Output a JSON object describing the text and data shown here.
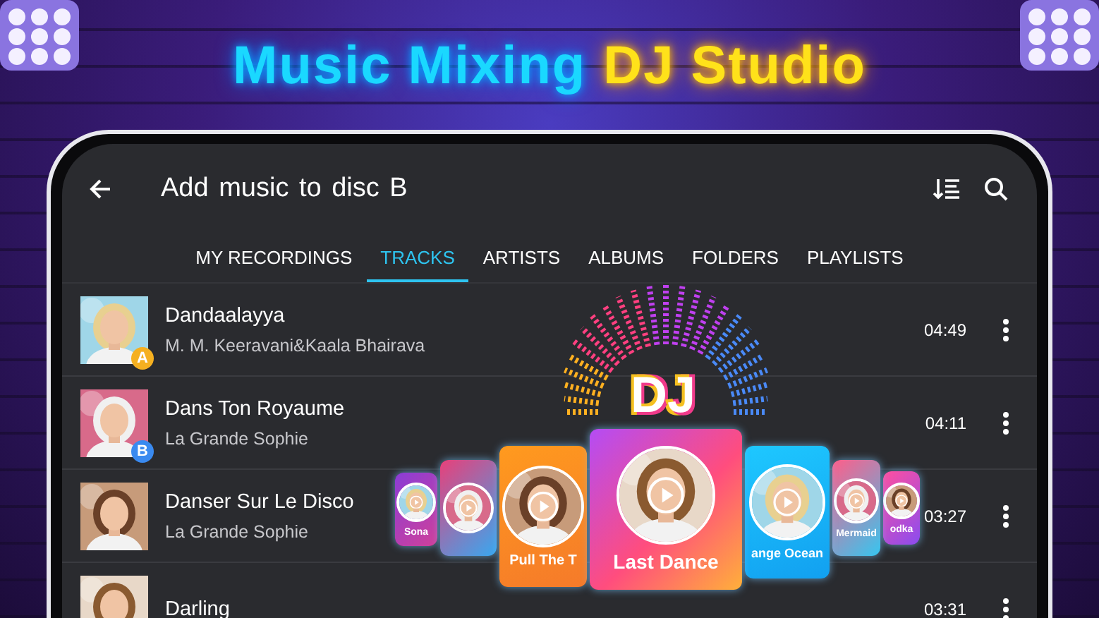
{
  "banner": {
    "title_start": "Music Mixing",
    "title_end": "DJ Studio"
  },
  "app_bar": {
    "title": "Add music to disc B"
  },
  "tabs": [
    {
      "label": "MY RECORDINGS",
      "selected": false
    },
    {
      "label": "TRACKS",
      "selected": true
    },
    {
      "label": "ARTISTS",
      "selected": false
    },
    {
      "label": "ALBUMS",
      "selected": false
    },
    {
      "label": "FOLDERS",
      "selected": false
    },
    {
      "label": "PLAYLISTS",
      "selected": false
    }
  ],
  "tracks": [
    {
      "title": "Dandaalayya",
      "artist": "M. M. Keeravani&Kaala Bhairava",
      "duration": "04:49",
      "badge": "A"
    },
    {
      "title": "Dans Ton Royaume",
      "artist": "La Grande Sophie",
      "duration": "04:11",
      "badge": "B"
    },
    {
      "title": "Danser Sur Le Disco",
      "artist": "La Grande Sophie",
      "duration": "03:27"
    },
    {
      "title": "Darling",
      "duration": "03:31"
    }
  ],
  "promo": {
    "logo": "DJ",
    "cards": [
      {
        "label": "Sona"
      },
      {
        "kind": "picture"
      },
      {
        "label": "Pull The T"
      },
      {
        "label": "Last Dance"
      },
      {
        "label": "ange Ocean"
      },
      {
        "label": "Mermaid"
      },
      {
        "label": "odka"
      }
    ]
  }
}
